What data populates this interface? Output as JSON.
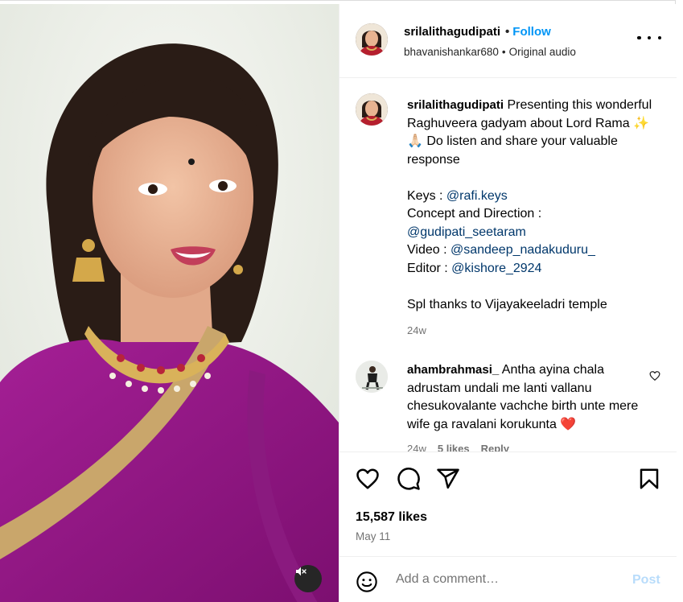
{
  "post": {
    "username": "srilalithagudipati",
    "follow_label": "Follow",
    "audio_user": "bhavanishankar680",
    "audio_label": "Original audio",
    "more_label": "More options"
  },
  "caption": {
    "username": "srilalithagudipati",
    "line1": "Presenting this wonderful Raghuveera gadyam about Lord Rama ✨ 🙏🏻 Do listen and share your valuable response",
    "keys_label": "Keys : ",
    "keys_mention": "@rafi.keys",
    "concept_label": "Concept and Direction :",
    "concept_mention": "@gudipati_seetaram",
    "video_label": "Video : ",
    "video_mention": "@sandeep_nadakuduru_",
    "editor_label": "Editor : ",
    "editor_mention": "@kishore_2924",
    "thanks": "Spl thanks to Vijayakeeladri temple",
    "time": "24w"
  },
  "comment": {
    "username": "ahambrahmasi_",
    "text": "Antha ayina chala adrustam undali me lanti vallanu chesukovalante vachche birth unte mere wife ga ravalani korukunta ❤️",
    "time": "24w",
    "likes": "5 likes",
    "reply": "Reply"
  },
  "actions": {
    "likes": "15,587 likes",
    "date": "May 11"
  },
  "add_comment": {
    "placeholder": "Add a comment…",
    "post_label": "Post"
  },
  "colors": {
    "accent": "#0095f6",
    "mention": "#00376b",
    "muted": "#737373",
    "post_disabled": "#b8dcfb",
    "saree": "#9b1a8c"
  },
  "icons": [
    "heart-icon",
    "comment-icon",
    "share-icon",
    "bookmark-icon",
    "emoji-icon",
    "mute-icon",
    "more-icon"
  ]
}
